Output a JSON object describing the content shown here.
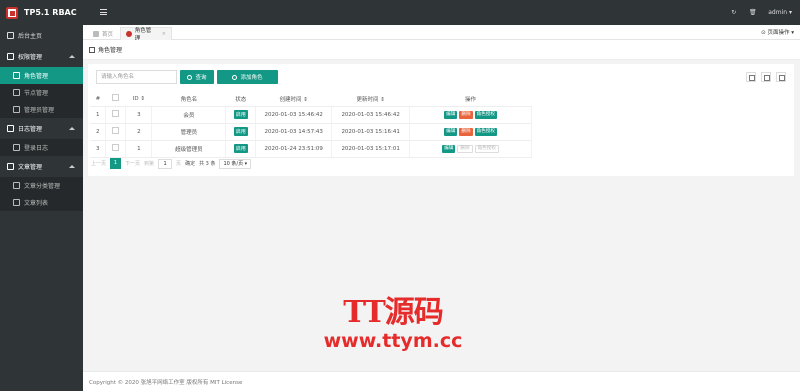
{
  "app": {
    "title": "TP5.1 RBAC"
  },
  "topbar": {
    "user": "admin",
    "user_caret": "▾",
    "refresh_icon": "↻",
    "trash_icon": "🗑"
  },
  "sidebar": {
    "home": "后台主页",
    "groups": [
      {
        "label": "权限管理",
        "items": [
          "角色管理",
          "节点管理",
          "管理员管理"
        ]
      },
      {
        "label": "日志管理",
        "items": [
          "登录日志"
        ]
      },
      {
        "label": "文章管理",
        "items": [
          "文章分类管理",
          "文章列表"
        ]
      }
    ],
    "active_item": "角色管理"
  },
  "tabs": {
    "home": "首页",
    "active": "角色管理",
    "close": "×",
    "page_ops": "页面操作"
  },
  "heading": {
    "title": "角色管理"
  },
  "toolbar": {
    "search_placeholder": "请输入角色名",
    "query": "查询",
    "add": "添加角色"
  },
  "table": {
    "columns": [
      "#",
      "",
      "ID ⇕",
      "角色名",
      "状态",
      "创建时间 ⇕",
      "更新时间 ⇕",
      "操作"
    ],
    "rows": [
      {
        "idx": "1",
        "id": "3",
        "name": "会员",
        "status": "启用",
        "created": "2020-01-03 15:46:42",
        "updated": "2020-01-03 15:46:42",
        "actions": [
          "编辑",
          "删除",
          "角色授权"
        ],
        "disabled": false
      },
      {
        "idx": "2",
        "id": "2",
        "name": "管理员",
        "status": "启用",
        "created": "2020-01-03 14:57:43",
        "updated": "2020-01-03 15:16:41",
        "actions": [
          "编辑",
          "删除",
          "角色授权"
        ],
        "disabled": false
      },
      {
        "idx": "3",
        "id": "1",
        "name": "超级管理员",
        "status": "启用",
        "created": "2020-01-24 23:51:09",
        "updated": "2020-01-03 15:17:01",
        "actions": [
          "编辑",
          "删除",
          "角色授权"
        ],
        "disabled": true
      }
    ]
  },
  "pager": {
    "prev": "上一页",
    "page": "1",
    "next": "下一页",
    "goto": "到第",
    "goto_value": "1",
    "page_unit": "页",
    "confirm": "确定",
    "total": "共 3 条",
    "size": "10 条/页 ▾"
  },
  "footer": {
    "text": "Copyright © 2020 张旭平网络工作室 版权所有 MIT License"
  },
  "watermark": {
    "line1": "TT源码",
    "line2": "www.ttym.cc"
  },
  "colors": {
    "accent": "#139886",
    "danger": "#e8643c",
    "sidebar": "#2f3437"
  }
}
